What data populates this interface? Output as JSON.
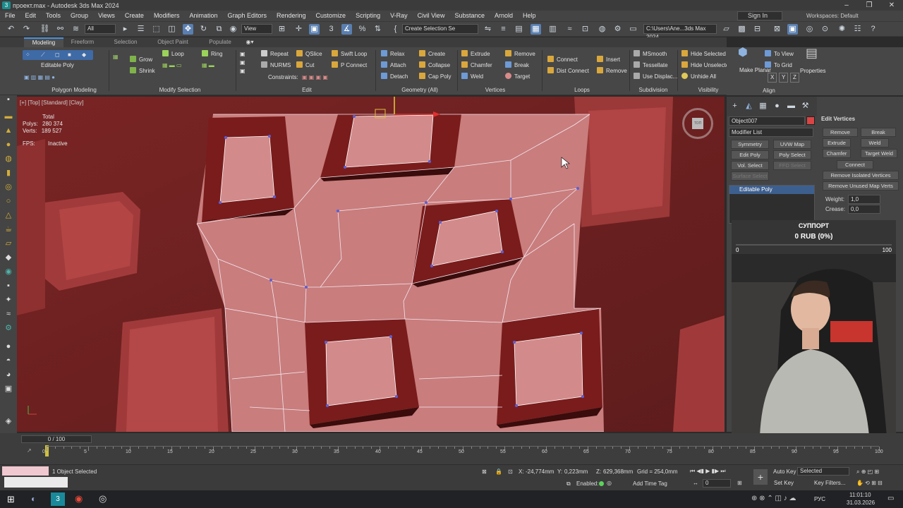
{
  "window": {
    "title": "проект.max - Autodesk 3ds Max 2024",
    "minimize": "–",
    "maximize": "❐",
    "close": "✕"
  },
  "menu": {
    "items": [
      "File",
      "Edit",
      "Tools",
      "Group",
      "Views",
      "Create",
      "Modifiers",
      "Animation",
      "Graph Editors",
      "Rendering",
      "Customize",
      "Scripting",
      "V-Ray",
      "Civil View",
      "Substance",
      "Arnold",
      "Help"
    ],
    "sign_in": "Sign In",
    "workspaces": "Workspaces: Default"
  },
  "toolbar": {
    "selection_filter": "All",
    "ref_coord": "View",
    "named_selection": "Create Selection Se",
    "path": "C:\\Users\\Ane...3ds Max 2024"
  },
  "ribbon_tabs": [
    "Modeling",
    "Freeform",
    "Selection",
    "Object Paint",
    "Populate"
  ],
  "ribbon": {
    "editable_poly": "Editable Poly",
    "polygon_modeling": "Polygon Modeling",
    "modify_selection": "Modify Selection",
    "grow": "Grow",
    "shrink": "Shrink",
    "loop": "Loop",
    "ring": "Ring",
    "edit_group": "Edit",
    "repeat": "Repeat",
    "qslice": "QSlice",
    "swift_loop": "Swift Loop",
    "nurms": "NURMS",
    "cut": "Cut",
    "p_connect": "P Connect",
    "constraints": "Constraints:",
    "geometry_all": "Geometry (All)",
    "relax": "Relax",
    "create": "Create",
    "attach": "Attach",
    "collapse": "Collapse",
    "detach": "Detach",
    "cap_poly": "Cap Poly",
    "vertices": "Vertices",
    "extrude": "Extrude",
    "remove": "Remove",
    "chamfer": "Chamfer",
    "break": "Break",
    "weld": "Weld",
    "target": "Target",
    "loops": "Loops",
    "connect": "Connect",
    "dist_connect": "Dist Connect",
    "insert": "Insert",
    "remove_loop": "Remove",
    "subdivision": "Subdivision",
    "msmooth": "MSmooth",
    "tessellate": "Tessellate",
    "use_displac": "Use Displac...",
    "visibility": "Visibility",
    "hide_selected": "Hide Selected",
    "hide_unselected": "Hide Unselected",
    "unhide_all": "Unhide All",
    "make_planar": "Make Planar",
    "align": "Align",
    "to_view": "To View",
    "to_grid": "To Grid",
    "x": "X",
    "y": "Y",
    "z": "Z",
    "properties": "Properties"
  },
  "viewport": {
    "label": "[+] [Top] [Standard] [Clay]",
    "stats_total": "Total",
    "polys_label": "Polys:",
    "polys": "280 374",
    "verts_label": "Verts:",
    "verts": "189 527",
    "fps_label": "FPS:",
    "fps": "Inactive",
    "viewcube_face": "ТОП"
  },
  "command_panel": {
    "object_name": "Object007",
    "modifier_list": "Modifier List",
    "symmetry": "Symmetry",
    "uvw_map": "UVW Map",
    "edit_poly": "Edit Poly",
    "poly_select": "Poly Select",
    "vol_select": "Vol. Select",
    "ffd_select": "FFD Select",
    "surface_select": "Surface Select",
    "stack_item": "Editable Poly",
    "rollout_title": "Edit Vertices",
    "remove": "Remove",
    "break": "Break",
    "extrude": "Extrude",
    "weld": "Weld",
    "chamfer": "Chamfer",
    "target_weld": "Target Weld",
    "connect": "Connect",
    "remove_isolated": "Remove Isolated Vertices",
    "remove_unused": "Remove Unused Map Verts",
    "weight_label": "Weight:",
    "weight": "1,0",
    "crease_label": "Crease:",
    "crease": "0,0"
  },
  "donation": {
    "title": "СУППОРТ",
    "amount": "0 RUB (0%)",
    "min": "0",
    "max": "100",
    "progress": 0
  },
  "timeline": {
    "frame_display": "0 / 100",
    "ticks": [
      "0",
      "5",
      "10",
      "15",
      "20",
      "25",
      "30",
      "35",
      "40",
      "45",
      "50",
      "55",
      "60",
      "65",
      "70",
      "75",
      "80",
      "85",
      "90",
      "95",
      "100"
    ]
  },
  "status": {
    "selected": "1 Object Selected",
    "x_label": "X:",
    "x": "-24,774mm",
    "y_label": "Y:",
    "y": "0,223mm",
    "z_label": "Z:",
    "z": "629,368mm",
    "grid": "Grid = 254,0mm",
    "enabled": "Enabled:",
    "add_time_tag": "Add Time Tag",
    "auto_key": "Auto Key",
    "selected_mode": "Selected",
    "set_key": "Set Key",
    "key_filters": "Key Filters...",
    "frame": "0"
  },
  "taskbar": {
    "lang": "РУС",
    "time": "11:01:10",
    "date": "31.03.2026"
  }
}
